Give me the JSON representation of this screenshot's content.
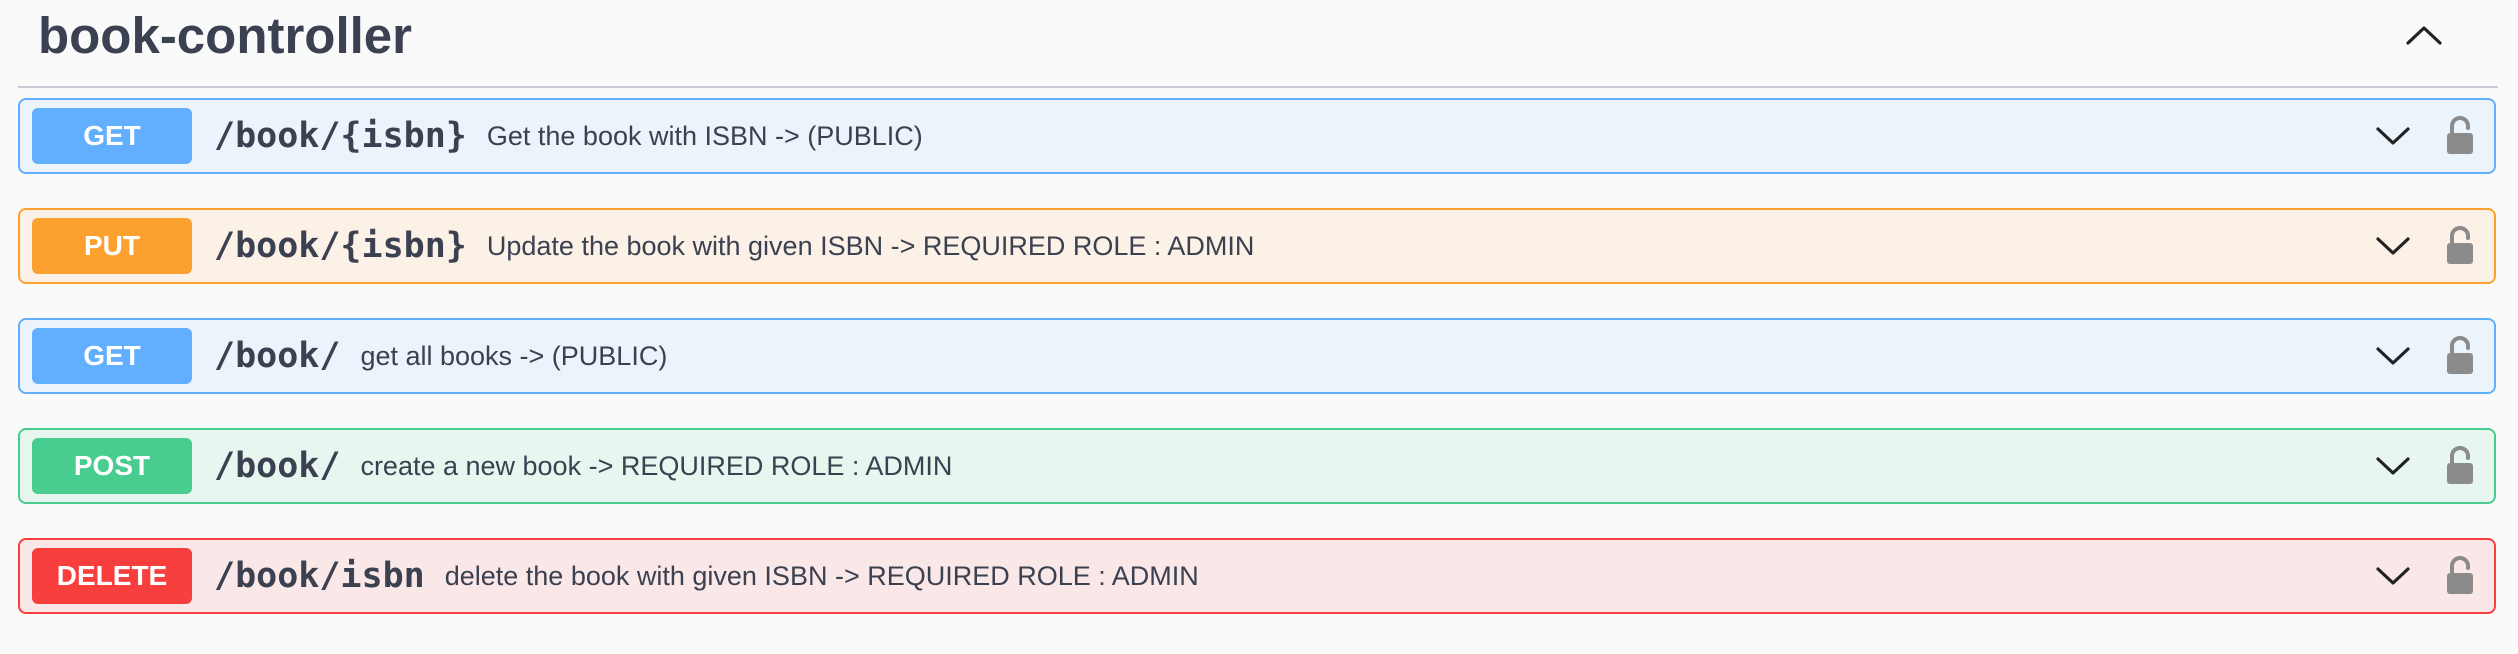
{
  "section": {
    "title": "book-controller",
    "collapse_icon": "chevron-up-icon"
  },
  "operations": [
    {
      "method": "GET",
      "path": "/book/{isbn}",
      "summary": "Get the book with ISBN -> (PUBLIC)",
      "color": "#61affe",
      "expand_icon": "chevron-down-icon",
      "auth_icon": "unlocked-icon"
    },
    {
      "method": "PUT",
      "path": "/book/{isbn}",
      "summary": "Update the book with given ISBN -> REQUIRED ROLE : ADMIN",
      "color": "#fca130",
      "expand_icon": "chevron-down-icon",
      "auth_icon": "unlocked-icon"
    },
    {
      "method": "GET",
      "path": "/book/",
      "summary": "get all books -> (PUBLIC)",
      "color": "#61affe",
      "expand_icon": "chevron-down-icon",
      "auth_icon": "unlocked-icon"
    },
    {
      "method": "POST",
      "path": "/book/",
      "summary": "create a new book -> REQUIRED ROLE : ADMIN",
      "color": "#49cc90",
      "expand_icon": "chevron-down-icon",
      "auth_icon": "unlocked-icon"
    },
    {
      "method": "DELETE",
      "path": "/book/isbn",
      "summary": "delete the book with given ISBN -> REQUIRED ROLE : ADMIN",
      "color": "#f93e3e",
      "expand_icon": "chevron-down-icon",
      "auth_icon": "unlocked-icon"
    }
  ]
}
